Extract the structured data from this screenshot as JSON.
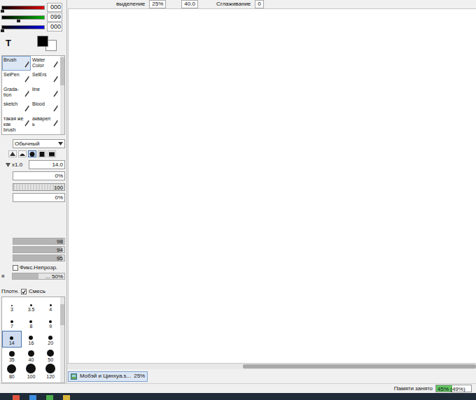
{
  "toolbar": {
    "selection": "выделение",
    "zoom": "25%",
    "angle": "40.0",
    "smoothing_label": "Сглаживание",
    "smoothing": "0"
  },
  "color_sliders": [
    {
      "value": "000",
      "level": 0,
      "color": "#e00000"
    },
    {
      "value": "099",
      "level": 0.39,
      "color": "#00b000"
    },
    {
      "value": "000",
      "level": 0,
      "color": "#0000e0"
    }
  ],
  "colors": {
    "primary": "#000000",
    "secondary": "#ffffff"
  },
  "text_tool": "T",
  "tools": [
    {
      "label": "Brush",
      "selected": true
    },
    {
      "label": "Water Color",
      "selected": false
    },
    {
      "label": "SelPen",
      "selected": false
    },
    {
      "label": "SelErs",
      "selected": false
    },
    {
      "label": "Grada-tion",
      "selected": false
    },
    {
      "label": "line",
      "selected": false
    },
    {
      "label": "sketch",
      "selected": false
    },
    {
      "label": "Blood",
      "selected": false
    },
    {
      "label": "такая же как brush",
      "selected": false
    },
    {
      "label": "акварель",
      "selected": false
    }
  ],
  "blend_mode": "Обычный",
  "brush_shapes": [
    {
      "selected": false
    },
    {
      "selected": false
    },
    {
      "selected": true
    },
    {
      "selected": false
    },
    {
      "selected": false
    }
  ],
  "size": {
    "multiplier": "x1.0",
    "value": "14.0"
  },
  "min_size": "0%",
  "density": {
    "value": "100",
    "level": 1
  },
  "texture": "0%",
  "sliders": [
    {
      "value": "98",
      "level": 0.98
    },
    {
      "value": "94",
      "level": 0.94
    },
    {
      "value": "95",
      "level": 0.95
    }
  ],
  "preserve_opacity": {
    "label": "Фикс.Непрозр.",
    "checked": false
  },
  "blend_row": {
    "label": "я",
    "value": "... 50%",
    "level": 0.5
  },
  "density_label": "Плотн.",
  "mix": {
    "label": "Смесь",
    "checked": true
  },
  "brush_sizes": [
    {
      "label": "3",
      "selected": false
    },
    {
      "label": "3.5",
      "selected": false
    },
    {
      "label": "4",
      "selected": false
    },
    {
      "label": "7",
      "selected": false
    },
    {
      "label": "8",
      "selected": false
    },
    {
      "label": "9",
      "selected": false
    },
    {
      "label": "14",
      "selected": true
    },
    {
      "label": "16",
      "selected": false
    },
    {
      "label": "20",
      "selected": false
    },
    {
      "label": "35",
      "selected": false
    },
    {
      "label": "40",
      "selected": false
    },
    {
      "label": "50",
      "selected": false
    },
    {
      "label": "80",
      "selected": false
    },
    {
      "label": "100",
      "selected": false
    },
    {
      "label": "120",
      "selected": false
    }
  ],
  "scrollbar": {
    "start": 0.43,
    "level": 0.57
  },
  "document_tabs": [
    {
      "title": "Мобэй и Цинхуа.s...",
      "zoom": "25%",
      "selected": true
    }
  ],
  "status": {
    "label": "Памяти занято",
    "value": "45% (49%)",
    "level": 0.45
  }
}
